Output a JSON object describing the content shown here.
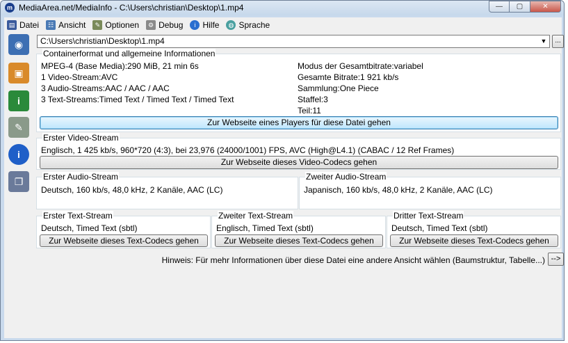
{
  "window": {
    "title": "MediaArea.net/MediaInfo - C:\\Users\\christian\\Desktop\\1.mp4",
    "app_icon": "mediainfo-icon",
    "caption_buttons": {
      "minimize": "—",
      "maximize": "▢",
      "close": "✕"
    }
  },
  "menu": {
    "items": [
      {
        "label": "Datei",
        "icon": "file-icon",
        "color": "#3a5a9c"
      },
      {
        "label": "Ansicht",
        "icon": "view-icon",
        "color": "#4a7ab5"
      },
      {
        "label": "Optionen",
        "icon": "options-icon",
        "color": "#7a8a5a"
      },
      {
        "label": "Debug",
        "icon": "debug-icon",
        "color": "#8a8a8a"
      },
      {
        "label": "Hilfe",
        "icon": "help-icon",
        "color": "#2a6fd0"
      },
      {
        "label": "Sprache",
        "icon": "language-icon",
        "color": "#4aa0a0"
      }
    ]
  },
  "sidebar": {
    "icons": [
      {
        "name": "open-file-icon",
        "glyph": "◉",
        "color": "#3d6fb3"
      },
      {
        "name": "open-folder-icon",
        "glyph": "▣",
        "color": "#d98a2a"
      },
      {
        "name": "export-info-icon",
        "glyph": "i",
        "color": "#2a8a3a"
      },
      {
        "name": "preferences-icon",
        "glyph": "✎",
        "color": "#8a9a8a"
      },
      {
        "name": "about-icon",
        "glyph": "i",
        "color": "#1f5fc8"
      },
      {
        "name": "copy-icon",
        "glyph": "❐",
        "color": "#6a7a9a"
      }
    ]
  },
  "file_selector": {
    "value": "C:\\Users\\christian\\Desktop\\1.mp4",
    "browse_label": "...",
    "arrow": "▼"
  },
  "general": {
    "legend": "Containerformat und allgemeine Informationen",
    "left_lines": [
      "MPEG-4 (Base Media):290 MiB, 21 min 6s",
      "1 Video-Stream:AVC",
      "3 Audio-Streams:AAC / AAC / AAC",
      "3 Text-Streams:Timed Text / Timed Text / Timed Text"
    ],
    "right_lines": [
      "Modus der Gesamtbitrate:variabel",
      "Gesamte Bitrate:1 921 kb/s",
      "Sammlung:One Piece",
      "Staffel:3",
      "Teil:11"
    ],
    "button": "Zur Webseite eines Players für diese Datei gehen"
  },
  "video": {
    "legend": "Erster Video-Stream",
    "line": "Englisch, 1 425 kb/s, 960*720 (4:3), bei 23,976 (24000/1001) FPS, AVC (High@L4.1) (CABAC / 12 Ref Frames)",
    "button": "Zur Webseite dieses Video-Codecs gehen"
  },
  "audio": [
    {
      "legend": "Erster Audio-Stream",
      "line": "Deutsch, 160 kb/s, 48,0 kHz, 2 Kanäle, AAC (LC)"
    },
    {
      "legend": "Zweiter Audio-Stream",
      "line": "Japanisch, 160 kb/s, 48,0 kHz, 2 Kanäle, AAC (LC)"
    }
  ],
  "text": [
    {
      "legend": "Erster Text-Stream",
      "line": "Deutsch, Timed Text (sbtl)",
      "button": "Zur Webseite dieses Text-Codecs gehen"
    },
    {
      "legend": "Zweiter Text-Stream",
      "line": "Englisch, Timed Text (sbtl)",
      "button": "Zur Webseite dieses Text-Codecs gehen"
    },
    {
      "legend": "Dritter Text-Stream",
      "line": "Deutsch, Timed Text (sbtl)",
      "button": "Zur Webseite dieses Text-Codecs gehen"
    }
  ],
  "hint": {
    "text": "Hinweis: Für mehr Informationen über diese Datei eine andere Ansicht wählen (Baumstruktur, Tabelle...)",
    "button": "-->"
  }
}
